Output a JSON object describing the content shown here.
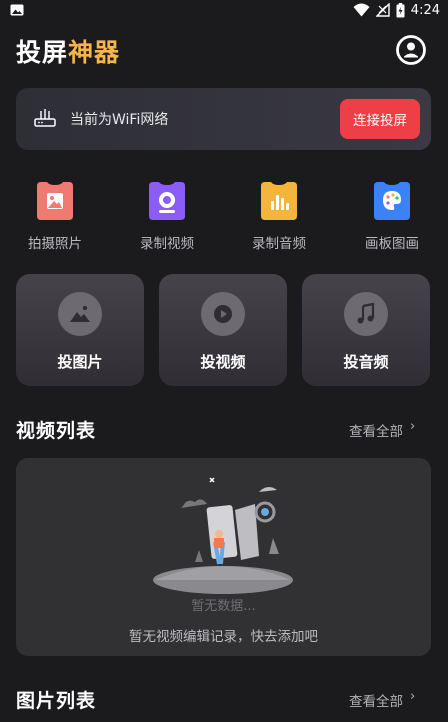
{
  "status_bar": {
    "time": "4:24"
  },
  "header": {
    "title_part1": "投屏",
    "title_part2": "神器",
    "profile_icon": "user-circle-icon"
  },
  "wifi_card": {
    "status_text": "当前为WiFi网络",
    "connect_label": "连接投屏"
  },
  "quick_actions": [
    {
      "label": "拍摄照片",
      "icon": "photo-icon",
      "color": "#f07a72"
    },
    {
      "label": "录制视频",
      "icon": "camera-icon",
      "color": "#8b5cf6"
    },
    {
      "label": "录制音频",
      "icon": "audio-bars-icon",
      "color": "#f5b43c"
    },
    {
      "label": "画板图画",
      "icon": "palette-icon",
      "color": "#3b82f6"
    }
  ],
  "cast_cards": [
    {
      "label": "投图片",
      "icon": "image-icon"
    },
    {
      "label": "投视频",
      "icon": "play-icon"
    },
    {
      "label": "投音频",
      "icon": "music-note-icon"
    }
  ],
  "video_section": {
    "title": "视频列表",
    "see_all": "查看全部",
    "chevron": "›"
  },
  "empty_state": {
    "title": "暂无数据...",
    "description": "暂无视频编辑记录，快去添加吧"
  },
  "image_section": {
    "title": "图片列表",
    "see_all": "查看全部",
    "chevron": "›"
  }
}
